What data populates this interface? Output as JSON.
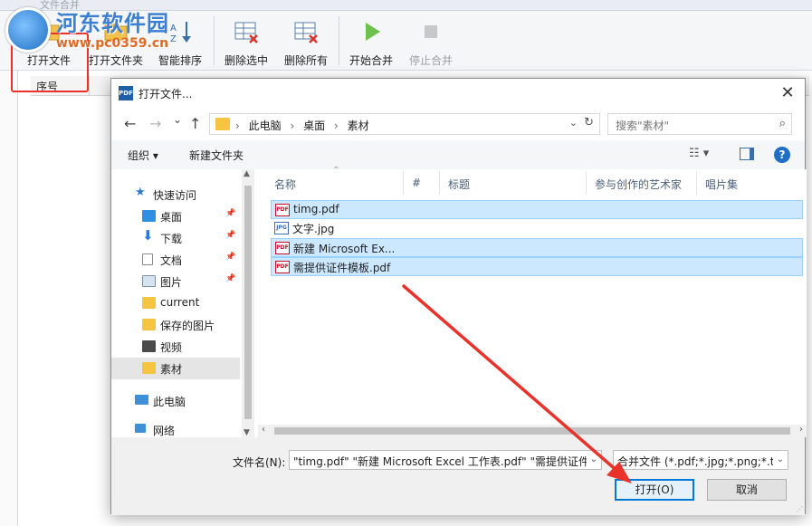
{
  "app": {
    "title": "文件合并",
    "toolbar": [
      {
        "key": "open_file",
        "label": "打开文件"
      },
      {
        "key": "open_folder",
        "label": "打开文件夹"
      },
      {
        "key": "smart_sort",
        "label": "智能排序"
      },
      {
        "key": "delete_selected",
        "label": "删除选中"
      },
      {
        "key": "delete_all",
        "label": "删除所有"
      },
      {
        "key": "start_merge",
        "label": "开始合并"
      },
      {
        "key": "stop_merge",
        "label": "停止合并"
      }
    ],
    "list_header": {
      "index": "序号"
    }
  },
  "watermark": {
    "name": "河东软件园",
    "url": "www.pc0359.cn"
  },
  "dialog": {
    "app_icon_text": "PDF",
    "title": "打开文件...",
    "close": "✕",
    "nav": {
      "back": "←",
      "forward": "→",
      "recent": "⌄",
      "up": "↑"
    },
    "address": {
      "crumbs": [
        "此电脑",
        "桌面",
        "素材"
      ],
      "separator": "›"
    },
    "search": {
      "placeholder": "搜索\"素材\""
    },
    "commands": {
      "organize": "组织 ▾",
      "new_folder": "新建文件夹",
      "help": "?"
    },
    "nav_items": [
      {
        "label": "快速访问",
        "icon": "star-icon",
        "top": true
      },
      {
        "label": "桌面",
        "icon": "desktop-icon",
        "pinned": true
      },
      {
        "label": "下载",
        "icon": "download-icon",
        "pinned": true
      },
      {
        "label": "文档",
        "icon": "document-icon",
        "pinned": true
      },
      {
        "label": "图片",
        "icon": "picture-icon",
        "pinned": true
      },
      {
        "label": "current",
        "icon": "folder-icon"
      },
      {
        "label": "保存的图片",
        "icon": "folder-icon"
      },
      {
        "label": "视频",
        "icon": "video-icon"
      },
      {
        "label": "素材",
        "icon": "folder-icon",
        "selected": true
      },
      {
        "label": "此电脑",
        "icon": "computer-icon",
        "top": true
      },
      {
        "label": "网络",
        "icon": "network-icon",
        "top": true
      }
    ],
    "columns": [
      "名称",
      "#",
      "标题",
      "参与创作的艺术家",
      "唱片集"
    ],
    "files": [
      {
        "name": "timg.pdf",
        "type": "pdf",
        "selected": true
      },
      {
        "name": "文字.jpg",
        "type": "img",
        "selected": false
      },
      {
        "name": "新建 Microsoft Ex...",
        "type": "pdf",
        "selected": true
      },
      {
        "name": "需提供证件模板.pdf",
        "type": "pdf",
        "selected": true
      }
    ],
    "filename_label": "文件名(N):",
    "filename_value": "\"timg.pdf\" \"新建 Microsoft Excel 工作表.pdf\" \"需提供证件",
    "filter_value": "合并文件 (*.pdf;*.jpg;*.png;*.t",
    "open_button": "打开(O)",
    "cancel_button": "取消"
  },
  "colors": {
    "accent": "#0078d7",
    "annotation": "#e8322a",
    "selection": "#cce8ff"
  }
}
